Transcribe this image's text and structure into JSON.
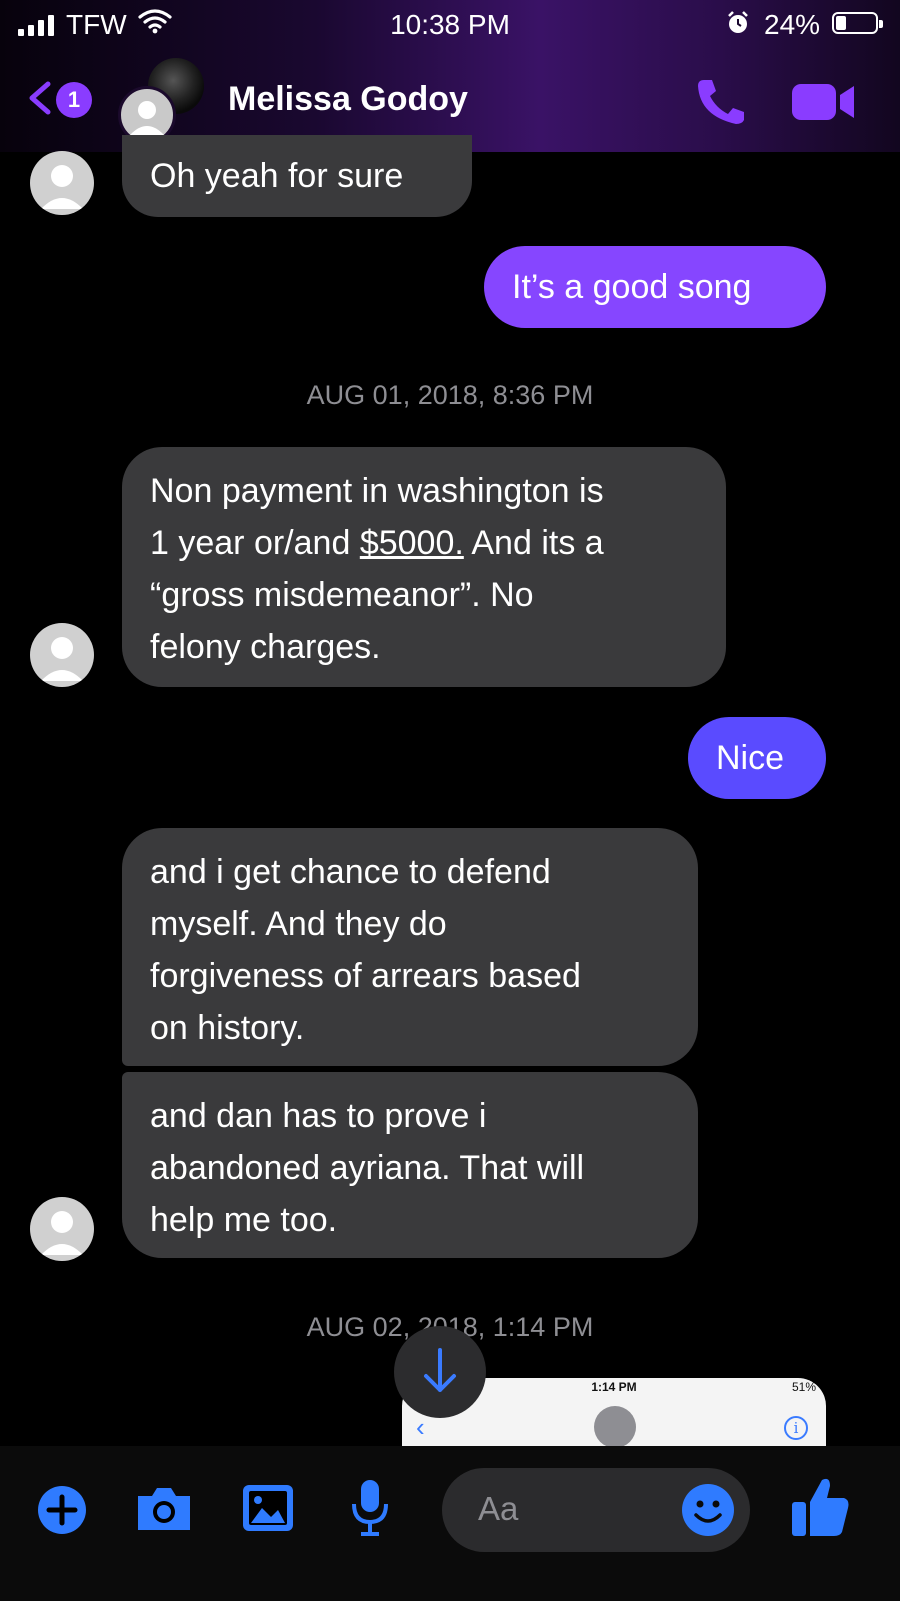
{
  "status_bar": {
    "carrier": "TFW",
    "time": "10:38 PM",
    "battery": "24%"
  },
  "header": {
    "unread_count": "1",
    "contact_name": "Melissa Godoy"
  },
  "messages": [
    {
      "text": "Oh yeah for sure"
    },
    {
      "text": "It’s a good song"
    },
    {
      "timestamp": "AUG 01, 2018, 8:36 PM"
    },
    {
      "lines": [
        "Non payment in washington is",
        "1 year or/and",
        "$5000.",
        " And its a",
        "“gross misdemeanor”. No",
        "felony charges."
      ]
    },
    {
      "text": "Nice"
    },
    {
      "lines": [
        "and i get chance to defend",
        "myself. And they do",
        "forgiveness of arrears based",
        "on history."
      ]
    },
    {
      "lines": [
        "and dan has to prove i",
        "abandoned ayriana. That will",
        "help me too."
      ]
    },
    {
      "timestamp": "AUG 02, 2018, 1:14 PM"
    }
  ],
  "image_preview": {
    "time": "1:14 PM",
    "status": "51%"
  },
  "composer": {
    "placeholder": "Aa"
  },
  "colors": {
    "outgoing_top": "#8a3cff",
    "outgoing_bottom": "#5a4bff",
    "incoming": "#3a3a3c",
    "accent_blue": "#3a7bff"
  }
}
